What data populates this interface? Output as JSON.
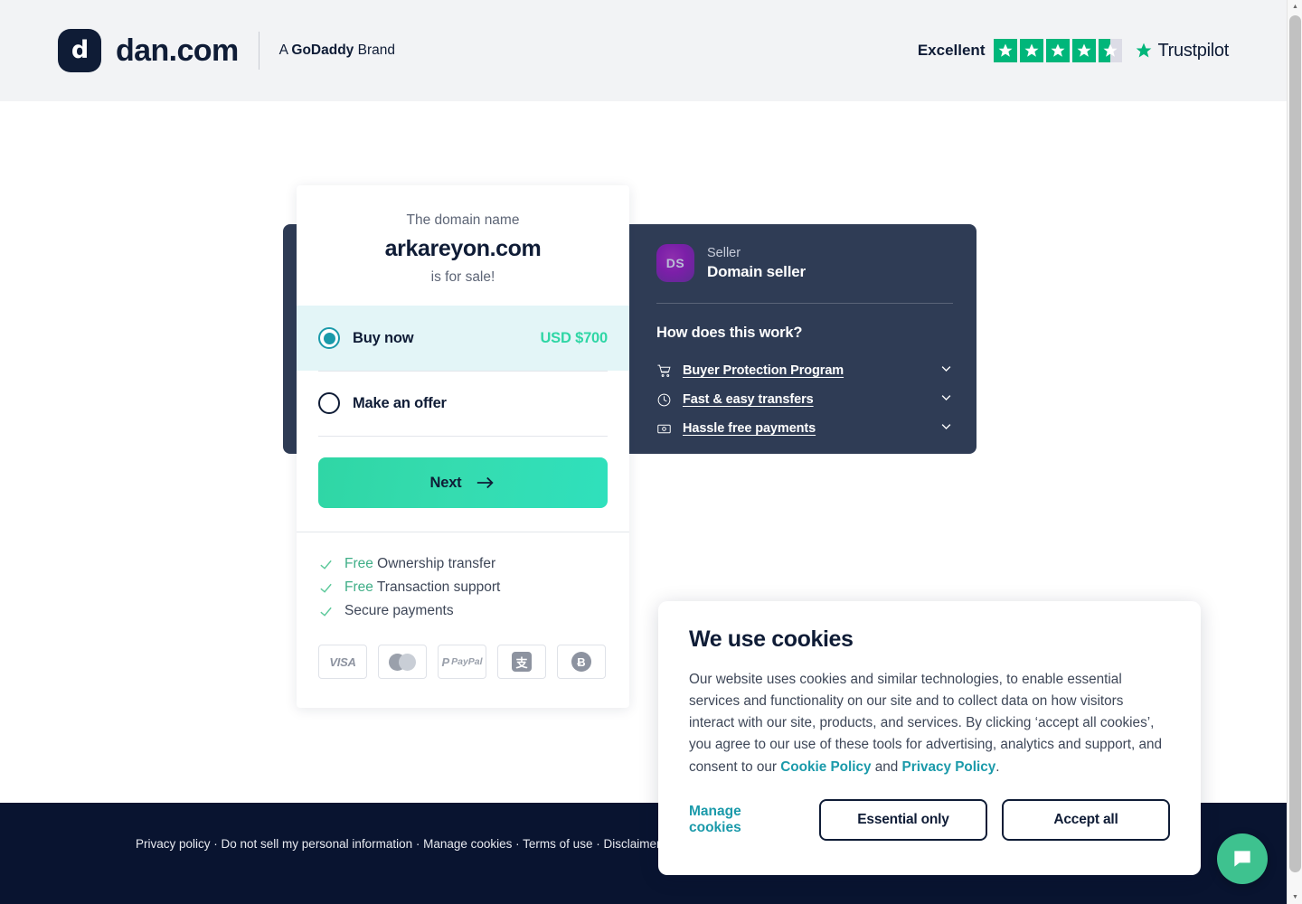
{
  "header": {
    "brand_mark": "d",
    "brand_name": "dan.com",
    "brand_sub_prefix": "A ",
    "brand_sub_strong": "GoDaddy",
    "brand_sub_suffix": " Brand",
    "trustpilot": {
      "rating_word": "Excellent",
      "brand": "Trustpilot",
      "stars_full": 4,
      "stars_half": 1,
      "star_color": "#00b67a"
    }
  },
  "card": {
    "kicker": "The domain name",
    "domain": "arkareyon.com",
    "tail": "is for sale!",
    "options": [
      {
        "label": "Buy now",
        "price": "USD $700",
        "selected": true
      },
      {
        "label": "Make an offer",
        "price": "",
        "selected": false
      }
    ],
    "next_label": "Next",
    "benefits": [
      {
        "free": "Free",
        "text": " Ownership transfer"
      },
      {
        "free": "Free",
        "text": " Transaction support"
      },
      {
        "free": "",
        "text": "Secure payments"
      }
    ],
    "payment_methods": [
      "VISA",
      "Mastercard",
      "PayPal",
      "Alipay",
      "Bitcoin"
    ],
    "payment_labels": {
      "visa": "VISA",
      "paypal_p": "P",
      "paypal_t": "PayPal",
      "alipay": "支",
      "bitcoin": "Ƀ"
    },
    "accent_price": "#2fd6a5",
    "selected_bg": "#e3f5f7"
  },
  "seller": {
    "avatar_initials": "DS",
    "role_label": "Seller",
    "name": "Domain seller",
    "how_title": "How does this work?",
    "items": [
      {
        "icon": "cart-icon",
        "label": "Buyer Protection Program"
      },
      {
        "icon": "clock-icon",
        "label": "Fast & easy transfers"
      },
      {
        "icon": "banknote-icon",
        "label": "Hassle free payments"
      }
    ]
  },
  "cookie": {
    "title": "We use cookies",
    "body_1": "Our website uses cookies and similar technologies, to enable essential services and functionality on our site and to collect data on how visitors interact with our site, products, and services. By clicking ‘accept all cookies’, you agree to our use of these tools for advertising, analytics and support, and consent to our ",
    "link_cookie": "Cookie Policy",
    "body_mid": " and ",
    "link_privacy": "Privacy Policy",
    "body_end": ".",
    "manage_label": "Manage cookies",
    "essential_label": "Essential only",
    "accept_label": "Accept all"
  },
  "footer": {
    "text": "Privacy policy · Do not sell my personal information · Manage cookies · Terms of use · Disclaimer subsidiary. All Rights Reserved."
  },
  "chat": {
    "icon": "chat-bubble-icon",
    "color": "#3ec28f"
  },
  "scrollbar": {
    "up": "▲",
    "down": "▼"
  }
}
